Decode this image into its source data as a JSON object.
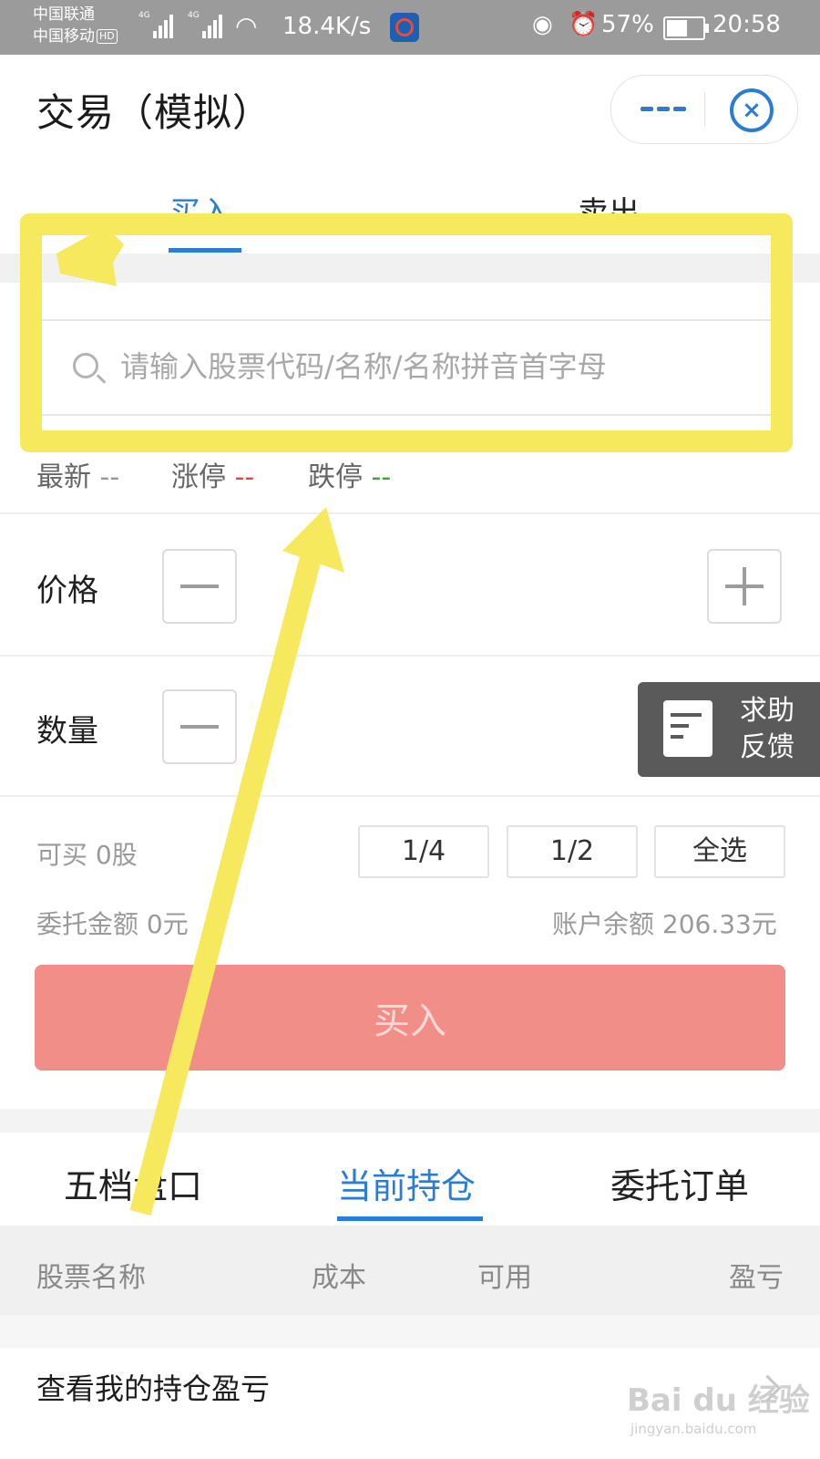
{
  "status_bar": {
    "carrier1": "中国联通",
    "carrier2": "中国移动",
    "hd": "HD",
    "net_label": "4G",
    "speed": "18.4K/s",
    "battery": "57%",
    "time": "20:58"
  },
  "header": {
    "title": "交易（模拟）"
  },
  "trade_tabs": [
    {
      "label": "买入"
    },
    {
      "label": "卖出"
    }
  ],
  "search": {
    "placeholder": "请输入股票代码/名称/名称拼音首字母"
  },
  "quote": {
    "latest_label": "最新",
    "latest_value": "--",
    "limit_up_label": "涨停",
    "limit_up_value": "--",
    "limit_down_label": "跌停",
    "limit_down_value": "--"
  },
  "form": {
    "price_label": "价格",
    "quantity_label": "数量",
    "available": "可买 0股",
    "fractions": [
      "1/4",
      "1/2",
      "全选"
    ],
    "order_amount": "委托金额 0元",
    "balance": "账户余额 206.33元",
    "buy_button": "买入"
  },
  "help": {
    "line1": "求助",
    "line2": "反馈"
  },
  "bottom_tabs": [
    {
      "label": "五档盘口"
    },
    {
      "label": "当前持仓"
    },
    {
      "label": "委托订单"
    }
  ],
  "table": {
    "columns": [
      "股票名称",
      "成本",
      "可用",
      "盈亏"
    ]
  },
  "pnl_row": {
    "label": "查看我的持仓盈亏"
  },
  "watermark": {
    "brand": "Bai du 经验",
    "url": "jingyan.baidu.com"
  },
  "colors": {
    "accent": "#2a7dd3",
    "buy_button": "#f28e88",
    "annotation": "#f7e95e"
  }
}
